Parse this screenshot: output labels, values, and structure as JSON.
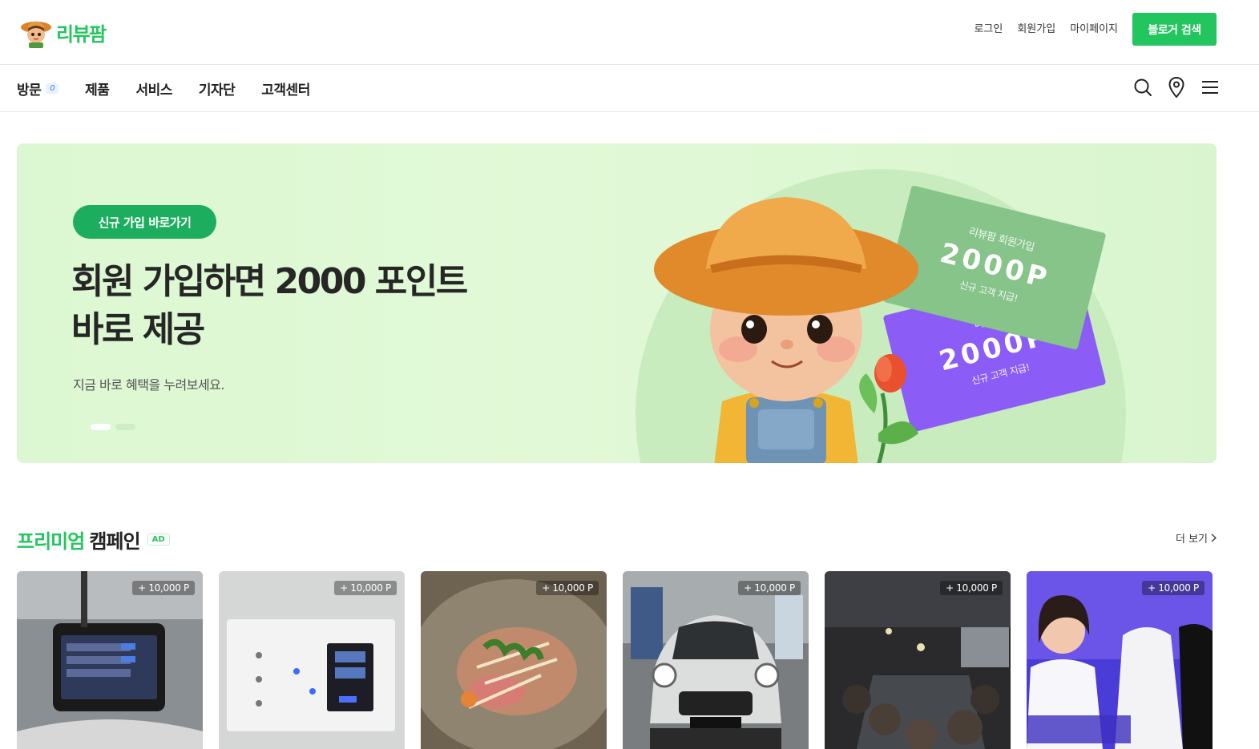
{
  "brand": {
    "name": "리뷰팜",
    "green": "#22c55e"
  },
  "top_links": {
    "login": "로그인",
    "signup": "회원가입",
    "mypage": "마이페이지",
    "blogger_search": "블로거 검색"
  },
  "nav": {
    "items": [
      {
        "label": "방문",
        "badge": "0"
      },
      {
        "label": "제품"
      },
      {
        "label": "서비스"
      },
      {
        "label": "기자단"
      },
      {
        "label": "고객센터"
      }
    ],
    "icons": [
      "search-icon",
      "location-pin-icon",
      "menu-icon"
    ]
  },
  "hero": {
    "pill": "신규 가입 바로가기",
    "title": "회원 가입하면 2000 포인트\n바로 제공",
    "subtitle": "지금 바로 혜택을 누려보세요.",
    "ticket_green": {
      "top": "리뷰팜 회원가입",
      "amount": "2000P",
      "bottom": "신규 고객 지급!"
    },
    "ticket_purple": {
      "top": "리뷰팜",
      "amount": "2000P",
      "bottom": "신규 고객 지급!"
    },
    "slides": {
      "total": 2,
      "active": 1
    }
  },
  "section": {
    "title_green": "프리미엄",
    "title_dark": "캠페인",
    "badge": "AD",
    "more": "더 보기"
  },
  "cards": [
    {
      "point": "+ 10,000 P",
      "theme": "dashcam"
    },
    {
      "point": "+ 10,000 P",
      "theme": "thermostat"
    },
    {
      "point": "+ 10,000 P",
      "theme": "food"
    },
    {
      "point": "+ 10,000 P",
      "theme": "car"
    },
    {
      "point": "+ 10,000 P",
      "theme": "restaurant"
    },
    {
      "point": "+ 10,000 P",
      "theme": "fashion"
    }
  ]
}
